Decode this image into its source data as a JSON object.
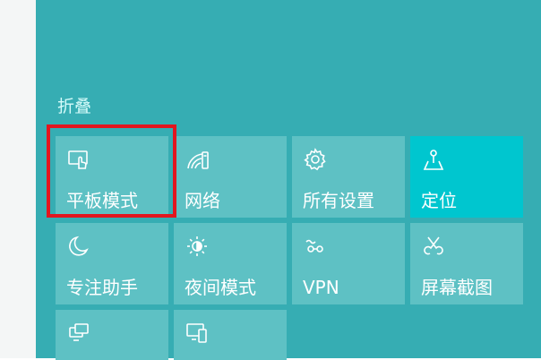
{
  "action_center": {
    "collapse_label": "折叠",
    "tiles": [
      {
        "label": "平板模式",
        "icon": "tablet-mode-icon",
        "active": false
      },
      {
        "label": "网络",
        "icon": "network-icon",
        "active": false
      },
      {
        "label": "所有设置",
        "icon": "settings-gear-icon",
        "active": false
      },
      {
        "label": "定位",
        "icon": "location-icon",
        "active": true
      },
      {
        "label": "专注助手",
        "icon": "moon-icon",
        "active": false
      },
      {
        "label": "夜间模式",
        "icon": "brightness-icon",
        "active": false
      },
      {
        "label": "VPN",
        "icon": "vpn-icon",
        "active": false
      },
      {
        "label": "屏幕截图",
        "icon": "screen-snip-icon",
        "active": false
      },
      {
        "label": "",
        "icon": "project-icon",
        "active": false
      },
      {
        "label": "",
        "icon": "connect-icon",
        "active": false
      }
    ]
  },
  "colors": {
    "panel_bg": "#36adb3",
    "tile_bg": "#5ec1c4",
    "tile_active_bg": "#00c6cf",
    "highlight": "#e2161f"
  }
}
